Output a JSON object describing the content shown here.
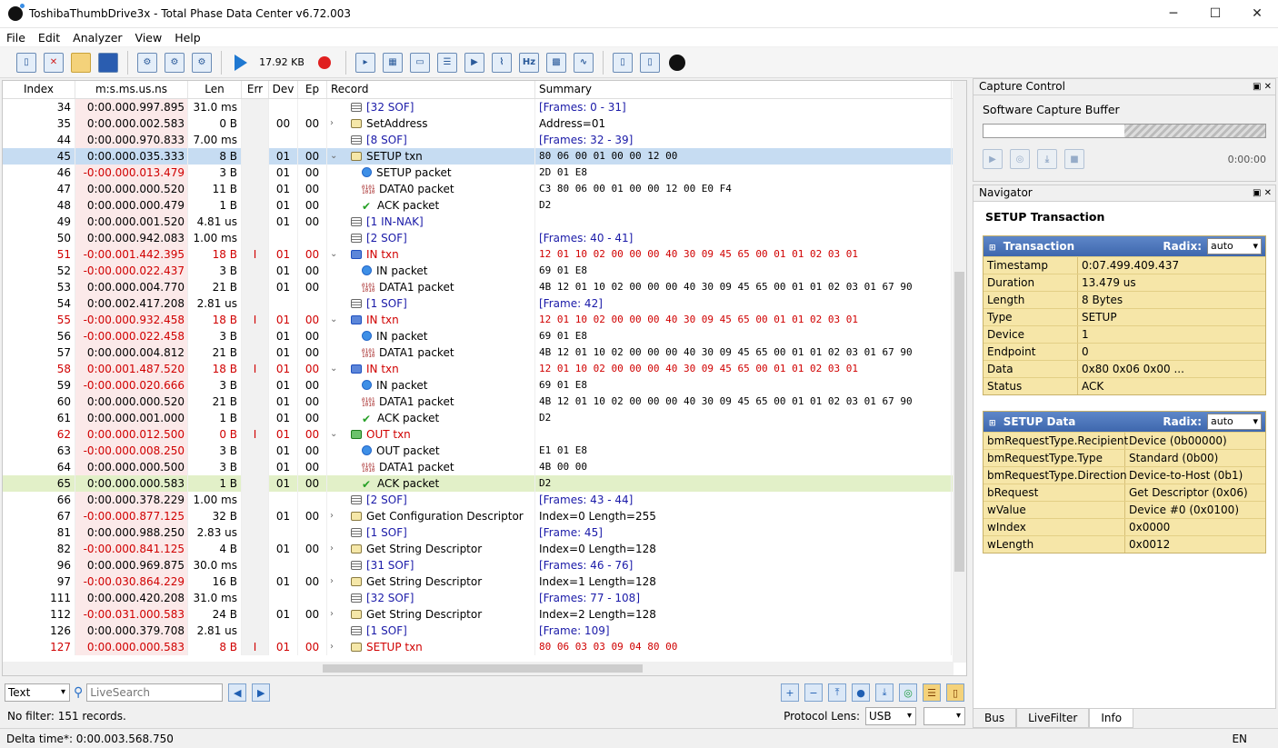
{
  "window": {
    "title": "ToshibaThumbDrive3x - Total Phase Data Center v6.72.003",
    "minimize": "─",
    "maximize": "☐",
    "close": "✕"
  },
  "menu": [
    "File",
    "Edit",
    "Analyzer",
    "View",
    "Help"
  ],
  "toolbar": {
    "buffer_size": "17.92 KB"
  },
  "columns": {
    "index": "Index",
    "timestamp": "m:s.ms.us.ns",
    "len": "Len",
    "err": "Err",
    "dev": "Dev",
    "ep": "Ep",
    "record": "Record",
    "summary": "Summary"
  },
  "rows": [
    {
      "idx": "34",
      "ts": "0:00.000.997.895",
      "len": "31.0 ms",
      "err": "",
      "dev": "",
      "ep": "",
      "rec": "[32 SOF]",
      "sum": "[Frames: 0 - 31]",
      "kind": "sof",
      "lvl": 0,
      "exp": "",
      "style": "blue"
    },
    {
      "idx": "35",
      "ts": "0:00.000.002.583",
      "len": "0 B",
      "err": "",
      "dev": "00",
      "ep": "00",
      "rec": "SetAddress",
      "sum": "Address=01",
      "kind": "txn",
      "lvl": 0,
      "exp": ">",
      "style": ""
    },
    {
      "idx": "44",
      "ts": "0:00.000.970.833",
      "len": "7.00 ms",
      "err": "",
      "dev": "",
      "ep": "",
      "rec": "[8 SOF]",
      "sum": "[Frames: 32 - 39]",
      "kind": "sof",
      "lvl": 0,
      "exp": "",
      "style": "blue"
    },
    {
      "idx": "45",
      "ts": "0:00.000.035.333",
      "len": "8 B",
      "err": "",
      "dev": "01",
      "ep": "00",
      "rec": "SETUP txn",
      "sum": "80 06 00 01 00 00 12 00",
      "kind": "txn",
      "lvl": 0,
      "exp": "v",
      "style": "sel mono"
    },
    {
      "idx": "46",
      "ts": "-0:00.000.013.479",
      "len": "3 B",
      "err": "",
      "dev": "01",
      "ep": "00",
      "rec": "SETUP packet",
      "sum": "2D 01 E8",
      "kind": "pkt",
      "lvl": 1,
      "exp": "",
      "style": "mono"
    },
    {
      "idx": "47",
      "ts": "0:00.000.000.520",
      "len": "11 B",
      "err": "",
      "dev": "01",
      "ep": "00",
      "rec": "DATA0 packet",
      "sum": "C3 80 06 00 01 00 00 12 00 E0 F4",
      "kind": "data",
      "lvl": 1,
      "exp": "",
      "style": "mono"
    },
    {
      "idx": "48",
      "ts": "0:00.000.000.479",
      "len": "1 B",
      "err": "",
      "dev": "01",
      "ep": "00",
      "rec": "ACK packet",
      "sum": "D2",
      "kind": "ok",
      "lvl": 1,
      "exp": "",
      "style": "mono"
    },
    {
      "idx": "49",
      "ts": "0:00.000.001.520",
      "len": "4.81 us",
      "err": "",
      "dev": "01",
      "ep": "00",
      "rec": "[1 IN-NAK]",
      "sum": "",
      "kind": "sof",
      "lvl": 0,
      "exp": "",
      "style": "blue"
    },
    {
      "idx": "50",
      "ts": "0:00.000.942.083",
      "len": "1.00 ms",
      "err": "",
      "dev": "",
      "ep": "",
      "rec": "[2 SOF]",
      "sum": "[Frames: 40 - 41]",
      "kind": "sof",
      "lvl": 0,
      "exp": "",
      "style": "blue"
    },
    {
      "idx": "51",
      "ts": "-0:00.001.442.395",
      "len": "18 B",
      "err": "I",
      "dev": "01",
      "ep": "00",
      "rec": "IN txn",
      "sum": "12 01 10 02 00 00 00 40 30 09 45 65 00 01 01 02 03 01",
      "kind": "blue",
      "lvl": 0,
      "exp": "v",
      "style": "err mono"
    },
    {
      "idx": "52",
      "ts": "-0:00.000.022.437",
      "len": "3 B",
      "err": "",
      "dev": "01",
      "ep": "00",
      "rec": "IN packet",
      "sum": "69 01 E8",
      "kind": "pkt",
      "lvl": 1,
      "exp": "",
      "style": "mono"
    },
    {
      "idx": "53",
      "ts": "0:00.000.004.770",
      "len": "21 B",
      "err": "",
      "dev": "01",
      "ep": "00",
      "rec": "DATA1 packet",
      "sum": "4B 12 01 10 02 00 00 00 40 30 09 45 65 00 01 01 02 03 01 67 90",
      "kind": "data",
      "lvl": 1,
      "exp": "",
      "style": "mono"
    },
    {
      "idx": "54",
      "ts": "0:00.002.417.208",
      "len": "2.81 us",
      "err": "",
      "dev": "",
      "ep": "",
      "rec": "[1 SOF]",
      "sum": "[Frame: 42]",
      "kind": "sof",
      "lvl": 0,
      "exp": "",
      "style": "blue"
    },
    {
      "idx": "55",
      "ts": "-0:00.000.932.458",
      "len": "18 B",
      "err": "I",
      "dev": "01",
      "ep": "00",
      "rec": "IN txn",
      "sum": "12 01 10 02 00 00 00 40 30 09 45 65 00 01 01 02 03 01",
      "kind": "blue",
      "lvl": 0,
      "exp": "v",
      "style": "err mono"
    },
    {
      "idx": "56",
      "ts": "-0:00.000.022.458",
      "len": "3 B",
      "err": "",
      "dev": "01",
      "ep": "00",
      "rec": "IN packet",
      "sum": "69 01 E8",
      "kind": "pkt",
      "lvl": 1,
      "exp": "",
      "style": "mono"
    },
    {
      "idx": "57",
      "ts": "0:00.000.004.812",
      "len": "21 B",
      "err": "",
      "dev": "01",
      "ep": "00",
      "rec": "DATA1 packet",
      "sum": "4B 12 01 10 02 00 00 00 40 30 09 45 65 00 01 01 02 03 01 67 90",
      "kind": "data",
      "lvl": 1,
      "exp": "",
      "style": "mono"
    },
    {
      "idx": "58",
      "ts": "0:00.001.487.520",
      "len": "18 B",
      "err": "I",
      "dev": "01",
      "ep": "00",
      "rec": "IN txn",
      "sum": "12 01 10 02 00 00 00 40 30 09 45 65 00 01 01 02 03 01",
      "kind": "blue",
      "lvl": 0,
      "exp": "v",
      "style": "err mono"
    },
    {
      "idx": "59",
      "ts": "-0:00.000.020.666",
      "len": "3 B",
      "err": "",
      "dev": "01",
      "ep": "00",
      "rec": "IN packet",
      "sum": "69 01 E8",
      "kind": "pkt",
      "lvl": 1,
      "exp": "",
      "style": "mono"
    },
    {
      "idx": "60",
      "ts": "0:00.000.000.520",
      "len": "21 B",
      "err": "",
      "dev": "01",
      "ep": "00",
      "rec": "DATA1 packet",
      "sum": "4B 12 01 10 02 00 00 00 40 30 09 45 65 00 01 01 02 03 01 67 90",
      "kind": "data",
      "lvl": 1,
      "exp": "",
      "style": "mono"
    },
    {
      "idx": "61",
      "ts": "0:00.000.001.000",
      "len": "1 B",
      "err": "",
      "dev": "01",
      "ep": "00",
      "rec": "ACK packet",
      "sum": "D2",
      "kind": "ok",
      "lvl": 1,
      "exp": "",
      "style": "mono"
    },
    {
      "idx": "62",
      "ts": "0:00.000.012.500",
      "len": "0 B",
      "err": "I",
      "dev": "01",
      "ep": "00",
      "rec": "OUT txn",
      "sum": "",
      "kind": "green",
      "lvl": 0,
      "exp": "v",
      "style": "err mono"
    },
    {
      "idx": "63",
      "ts": "-0:00.000.008.250",
      "len": "3 B",
      "err": "",
      "dev": "01",
      "ep": "00",
      "rec": "OUT packet",
      "sum": "E1 01 E8",
      "kind": "pkt",
      "lvl": 1,
      "exp": "",
      "style": "mono"
    },
    {
      "idx": "64",
      "ts": "0:00.000.000.500",
      "len": "3 B",
      "err": "",
      "dev": "01",
      "ep": "00",
      "rec": "DATA1 packet",
      "sum": "4B 00 00",
      "kind": "data",
      "lvl": 1,
      "exp": "",
      "style": "mono"
    },
    {
      "idx": "65",
      "ts": "0:00.000.000.583",
      "len": "1 B",
      "err": "",
      "dev": "01",
      "ep": "00",
      "rec": "ACK packet",
      "sum": "D2",
      "kind": "ok",
      "lvl": 1,
      "exp": "",
      "style": "hi mono"
    },
    {
      "idx": "66",
      "ts": "0:00.000.378.229",
      "len": "1.00 ms",
      "err": "",
      "dev": "",
      "ep": "",
      "rec": "[2 SOF]",
      "sum": "[Frames: 43 - 44]",
      "kind": "sof",
      "lvl": 0,
      "exp": "",
      "style": "blue"
    },
    {
      "idx": "67",
      "ts": "-0:00.000.877.125",
      "len": "32 B",
      "err": "",
      "dev": "01",
      "ep": "00",
      "rec": "Get Configuration Descriptor",
      "sum": "Index=0 Length=255",
      "kind": "txn",
      "lvl": 0,
      "exp": ">",
      "style": ""
    },
    {
      "idx": "81",
      "ts": "0:00.000.988.250",
      "len": "2.83 us",
      "err": "",
      "dev": "",
      "ep": "",
      "rec": "[1 SOF]",
      "sum": "[Frame: 45]",
      "kind": "sof",
      "lvl": 0,
      "exp": "",
      "style": "blue"
    },
    {
      "idx": "82",
      "ts": "-0:00.000.841.125",
      "len": "4 B",
      "err": "",
      "dev": "01",
      "ep": "00",
      "rec": "Get String Descriptor",
      "sum": "Index=0 Length=128",
      "kind": "txn",
      "lvl": 0,
      "exp": ">",
      "style": ""
    },
    {
      "idx": "96",
      "ts": "0:00.000.969.875",
      "len": "30.0 ms",
      "err": "",
      "dev": "",
      "ep": "",
      "rec": "[31 SOF]",
      "sum": "[Frames: 46 - 76]",
      "kind": "sof",
      "lvl": 0,
      "exp": "",
      "style": "blue"
    },
    {
      "idx": "97",
      "ts": "-0:00.030.864.229",
      "len": "16 B",
      "err": "",
      "dev": "01",
      "ep": "00",
      "rec": "Get String Descriptor",
      "sum": "Index=1 Length=128",
      "kind": "txn",
      "lvl": 0,
      "exp": ">",
      "style": ""
    },
    {
      "idx": "111",
      "ts": "0:00.000.420.208",
      "len": "31.0 ms",
      "err": "",
      "dev": "",
      "ep": "",
      "rec": "[32 SOF]",
      "sum": "[Frames: 77 - 108]",
      "kind": "sof",
      "lvl": 0,
      "exp": "",
      "style": "blue"
    },
    {
      "idx": "112",
      "ts": "-0:00.031.000.583",
      "len": "24 B",
      "err": "",
      "dev": "01",
      "ep": "00",
      "rec": "Get String Descriptor",
      "sum": "Index=2 Length=128",
      "kind": "txn",
      "lvl": 0,
      "exp": ">",
      "style": ""
    },
    {
      "idx": "126",
      "ts": "0:00.000.379.708",
      "len": "2.81 us",
      "err": "",
      "dev": "",
      "ep": "",
      "rec": "[1 SOF]",
      "sum": "[Frame: 109]",
      "kind": "sof",
      "lvl": 0,
      "exp": "",
      "style": "blue"
    },
    {
      "idx": "127",
      "ts": "0:00.000.000.583",
      "len": "8 B",
      "err": "I",
      "dev": "01",
      "ep": "00",
      "rec": "SETUP txn",
      "sum": "80 06 03 03 09 04 80 00",
      "kind": "txn",
      "lvl": 0,
      "exp": ">",
      "style": "err mono"
    }
  ],
  "bottom": {
    "view_mode": "Text",
    "search_placeholder": "LiveSearch",
    "filter_status": "No filter: 151 records.",
    "protocol_lens_label": "Protocol Lens:",
    "protocol_lens": "USB"
  },
  "status": {
    "delta": "Delta time*: 0:00.003.568.750",
    "lang": "EN"
  },
  "capture": {
    "title": "Capture Control",
    "buffer_label": "Software Capture Buffer",
    "buffer_fill": 0.5,
    "time": "0:00:00"
  },
  "navigator": {
    "title": "Navigator",
    "heading": "SETUP Transaction",
    "transaction": {
      "title": "Transaction",
      "radix_label": "Radix:",
      "radix": "auto",
      "fields": [
        [
          "Timestamp",
          "0:07.499.409.437"
        ],
        [
          "Duration",
          "13.479 us"
        ],
        [
          "Length",
          "8 Bytes"
        ],
        [
          "Type",
          "SETUP"
        ],
        [
          "Device",
          "1"
        ],
        [
          "Endpoint",
          "0"
        ],
        [
          "Data",
          "0x80 0x06 0x00 ..."
        ],
        [
          "Status",
          "ACK"
        ]
      ]
    },
    "setup": {
      "title": "SETUP Data",
      "radix_label": "Radix:",
      "radix": "auto",
      "fields": [
        [
          "bmRequestType.Recipient",
          "Device (0b00000)"
        ],
        [
          "bmRequestType.Type",
          "Standard (0b00)"
        ],
        [
          "bmRequestType.Direction",
          "Device-to-Host (0b1)"
        ],
        [
          "bRequest",
          "Get Descriptor (0x06)"
        ],
        [
          "wValue",
          "Device #0 (0x0100)"
        ],
        [
          "wIndex",
          "0x0000"
        ],
        [
          "wLength",
          "0x0012"
        ]
      ]
    }
  },
  "tabs": [
    "Bus",
    "LiveFilter",
    "Info"
  ]
}
